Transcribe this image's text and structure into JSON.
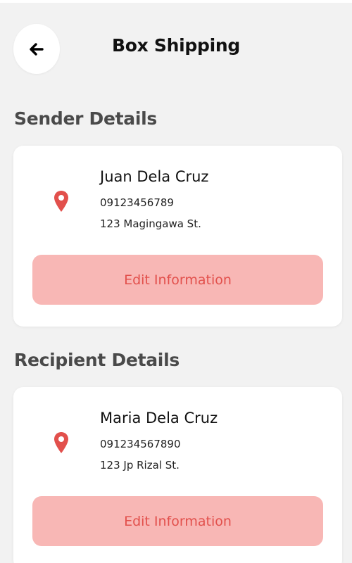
{
  "header": {
    "title": "Box Shipping"
  },
  "sender": {
    "section_title": "Sender Details",
    "name": "Juan Dela Cruz",
    "phone": "09123456789",
    "address": "123 Magingawa St.",
    "edit_label": "Edit Information"
  },
  "recipient": {
    "section_title": "Recipient Details",
    "name": "Maria Dela Cruz",
    "phone": "091234567890",
    "address": "123 Jp Rizal St.",
    "edit_label": "Edit Information"
  },
  "icons": {
    "back": "arrow-left-icon",
    "location": "map-pin-icon"
  },
  "colors": {
    "accent": "#e2504c",
    "button_bg": "#f8b7b5",
    "background": "#f2f2f2"
  }
}
